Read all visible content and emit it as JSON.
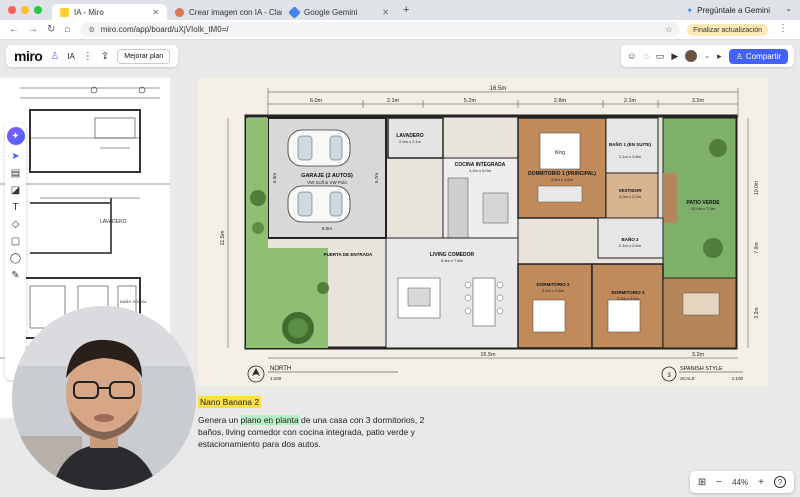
{
  "browser": {
    "tabs": [
      {
        "title": "IA - Miro",
        "active": true,
        "favicon_color": "#ffd02f"
      },
      {
        "title": "Crear imagen con IA - Claude",
        "active": false,
        "favicon_color": "#d97757"
      },
      {
        "title": "Google Gemini",
        "active": false,
        "favicon_color": "#4285f4"
      }
    ],
    "new_tab": "+",
    "gemini_button": "Pregúntale a Gemini",
    "url": "miro.com/app/board/uXjVIoIk_tM0=/",
    "update_button": "Finalizar actualización"
  },
  "miro": {
    "logo": "miro",
    "board_name": "IA",
    "upgrade_button": "Mejorar plan",
    "share_button": "Compartir",
    "zoom_level": "44%",
    "help": "?"
  },
  "toolbar_icons": [
    "ai-sparkle-icon",
    "select-cursor-icon",
    "templates-icon",
    "sticky-note-icon",
    "text-icon",
    "shapes-icon",
    "frame-icon",
    "comment-icon",
    "pen-icon"
  ],
  "floorplan": {
    "title_north": "NORTH",
    "scale_north": "1:100",
    "style_number": "3",
    "style_title": "SPANISH STYLE",
    "style_scale_label": "SCALE",
    "style_scale": "1:100",
    "dims_top": [
      "6.0m",
      "2.1m",
      "5.2m",
      "2.8m",
      "2.1m",
      "3.2m"
    ],
    "total_width": "16.5m",
    "total_height": "11.5m",
    "rooms": [
      {
        "name": "LAVADERO",
        "size": "2.0m x 2.1m"
      },
      {
        "name": "GARAJE (2 AUTOS)",
        "size": "VW Golf & VW Polo"
      },
      {
        "name": "COCINA INTEGRADA",
        "size": "3.2m x 5.0m"
      },
      {
        "name": "DORMITORIO 1 (PRINCIPAL)",
        "size": "3.8m x 4.5m"
      },
      {
        "name": "BAÑO 1 (EN SUITE)",
        "size": "2.1m x 2.8m"
      },
      {
        "name": "VESTIDOR",
        "size": "2.0m x 2.2m"
      },
      {
        "name": "PATIO VERDE",
        "size": "10.0m x 7.0m"
      },
      {
        "name": "BAÑO 2",
        "size": "2.1m x 2.6m"
      },
      {
        "name": "LIVING COMEDOR",
        "size": "5.4m x 7.8m"
      },
      {
        "name": "PUERTA DE ENTRADA",
        "size": ""
      },
      {
        "name": "DORMITORIO 2",
        "size": "3.2m x 3.6m"
      },
      {
        "name": "DORMITORIO 3",
        "size": "3.2m x 3.6m"
      }
    ],
    "bed_label": "King",
    "garage_width": "6.0m",
    "garage_depth": "6.3m",
    "garage_side": "5.7m",
    "bottom_dim": "16.5m",
    "bottom_right_dim": "3.2m",
    "right_dims": [
      "10.0m",
      "7.0m",
      "3.2m"
    ]
  },
  "left_plan": {
    "labels": [
      "LAVADERO",
      "BAÑO SOCIAL"
    ]
  },
  "caption": {
    "tag": "Nano Banana 2",
    "before": "Genera un ",
    "highlight": "plano en planta",
    "after": " de una casa con 3 dormitorios, 2 baños, living comedor con cocina integrada, patio verde y estacionamiento para dos autos."
  },
  "colors": {
    "miro_blue": "#4262ff",
    "garden_green": "#7fb069",
    "wood_floor": "#c08a5a",
    "highlight_yellow": "#fde047",
    "highlight_green": "#b8f0c5"
  }
}
